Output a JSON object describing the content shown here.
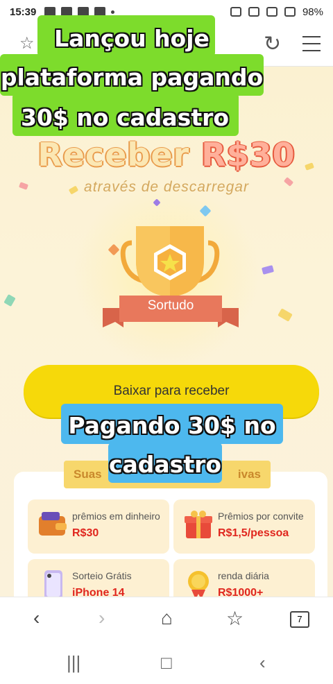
{
  "status_bar": {
    "time": "15:39",
    "battery": "98%"
  },
  "icons": {
    "bookmark": "star-icon",
    "reload": "reload-icon",
    "menu": "menu-icon"
  },
  "promo": {
    "title_word": "Receber",
    "title_amount": "R$30",
    "subtitle": "através de descarregar",
    "badge_label": "Sortudo",
    "download_button": "Baixar para receber"
  },
  "rewards": {
    "banner_left": "Suas",
    "banner_right": "ivas",
    "tiles": [
      {
        "label": "prêmios em dinheiro",
        "value": "R$30",
        "icon": "wallet-icon"
      },
      {
        "label": "Prêmios por convite",
        "value": "R$1,5/pessoa",
        "icon": "gift-icon"
      },
      {
        "label": "Sorteio Grátis",
        "value": "iPhone 14",
        "icon": "phone-icon"
      },
      {
        "label": "renda diária",
        "value": "R$1000+",
        "icon": "medal-icon"
      }
    ]
  },
  "captions": {
    "green_line1": "Lançou hoje",
    "green_line2": "plataforma pagando",
    "green_line3": "30$ no cadastro",
    "blue_line1": "Pagando 30$ no",
    "blue_line2": "cadastro"
  },
  "bottom_nav": {
    "tabs_count": "7"
  },
  "colors": {
    "download_button": "#f6d90a",
    "green_caption": "#7ddc2c",
    "blue_caption": "#4db8ee",
    "reward_value": "#e0261e"
  }
}
